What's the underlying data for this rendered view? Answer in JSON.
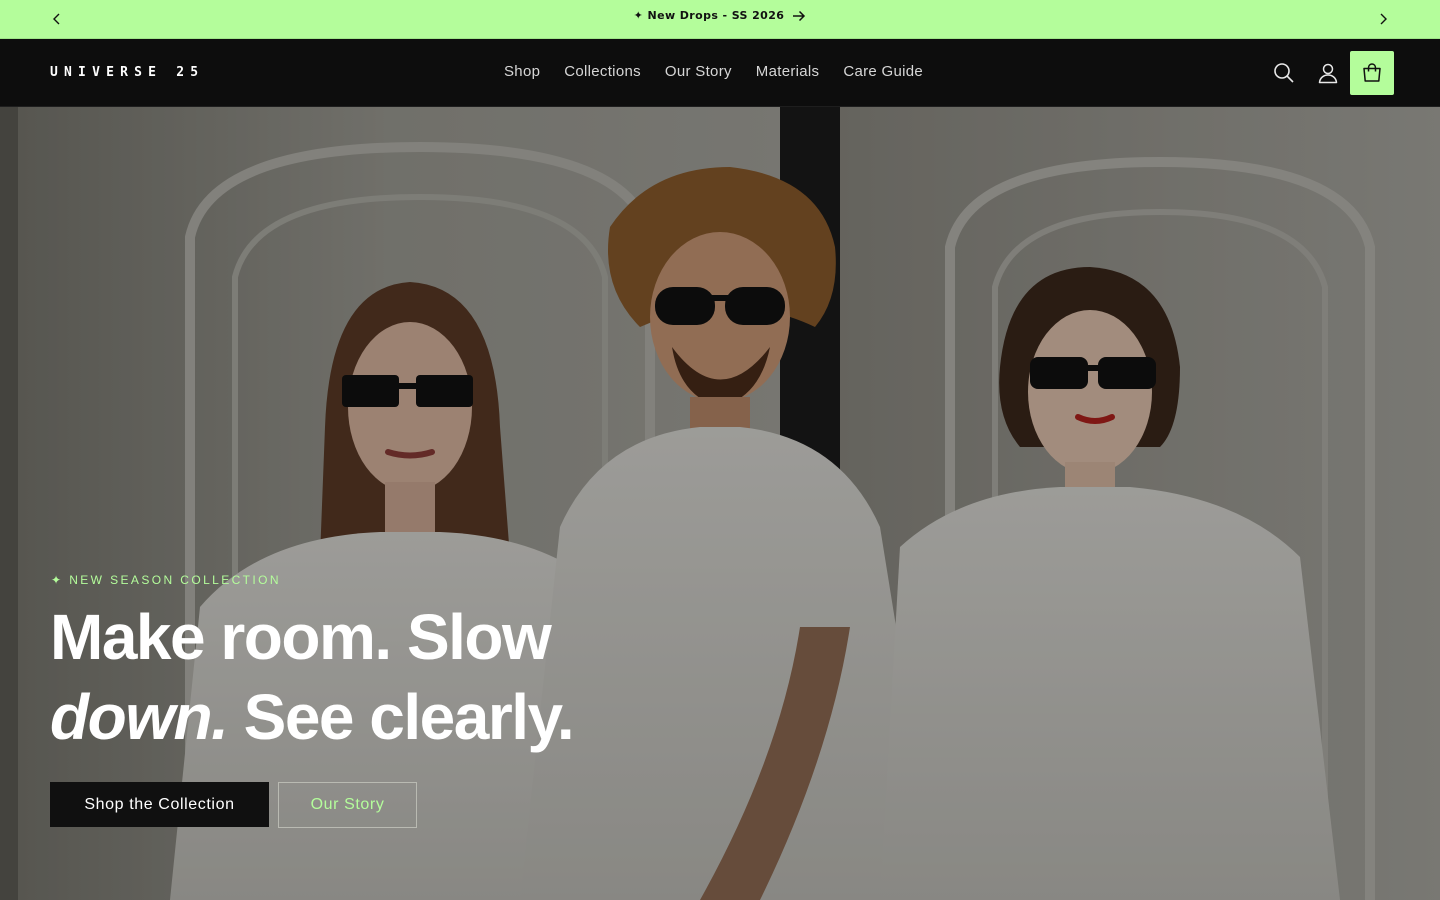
{
  "announcement": {
    "text": "✦ New Drops - SS 2026",
    "prev_icon": "chevron-left-icon",
    "next_icon": "chevron-right-icon",
    "link_icon": "arrow-right-icon"
  },
  "header": {
    "logo": "UNIVERSE 25",
    "nav": [
      "Shop",
      "Collections",
      "Our Story",
      "Materials",
      "Care Guide"
    ],
    "icons": [
      "search-icon",
      "account-icon",
      "cart-icon"
    ]
  },
  "hero": {
    "eyebrow": "✦ NEW SEASON COLLECTION",
    "headline_line1": "Make room. Slow",
    "headline_italic": "down.",
    "headline_line2_rest": " See clearly.",
    "primary_cta": "Shop the Collection",
    "secondary_cta": "Our Story"
  },
  "colors": {
    "accent": "#b4fd9b",
    "header_bg": "#0d0d0d",
    "primary_button_bg": "#101010"
  }
}
